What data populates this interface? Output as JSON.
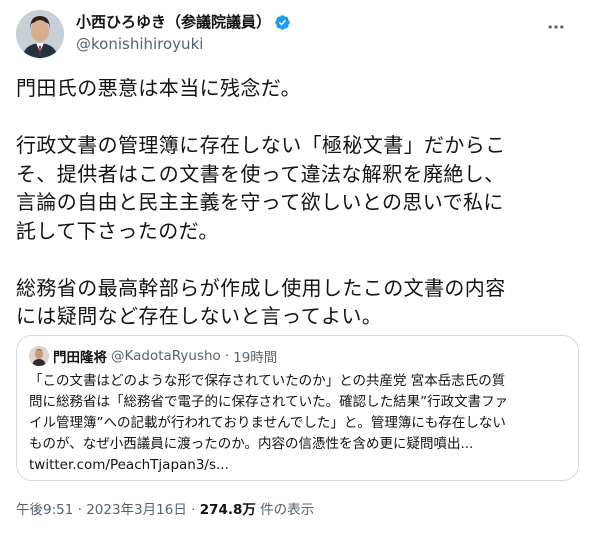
{
  "author": {
    "display_name": "小西ひろゆき（参議院議員）",
    "handle": "@konishihiroyuki"
  },
  "tweet": {
    "text": "門田氏の悪意は本当に残念だ。\n\n行政文書の管理簿に存在しない「極秘文書」だからこ\nそ、提供者はこの文書を使って違法な解釈を廃絶し、\n言論の自由と民主主義を守って欲しいとの思いで私に\n託して下さったのだ。\n\n総務省の最高幹部らが作成し使用したこの文書の内容\nには疑問など存在しないと言ってよい。"
  },
  "quote": {
    "name": "門田隆将",
    "handle": "@KadotaRyusho",
    "separator": "·",
    "time": "19時間",
    "text": "「この文書はどのような形で保存されていたのか」との共産党 宮本岳志氏の質\n問に総務省は「総務省で電子的に保存されていた。確認した結果”行政文書ファ\nイル管理簿”への記載が行われておりませんでした」と。管理簿にも存在しない\nものが、なぜ小西議員に渡ったのか。内容の信憑性を含め更に疑問噴出...\ntwitter.com/PeachTjapan3/s..."
  },
  "meta": {
    "timestamp": "午後9:51 · 2023年3月16日 · ",
    "views_count": "274.8万",
    "views_label": " 件の表示"
  },
  "icons": {
    "verified": "verified-badge-icon",
    "more": "more-options-icon"
  },
  "colors": {
    "verified": "#1d9bf0",
    "text": "#0f1419",
    "secondary": "#536471",
    "border": "#cfd9de"
  }
}
